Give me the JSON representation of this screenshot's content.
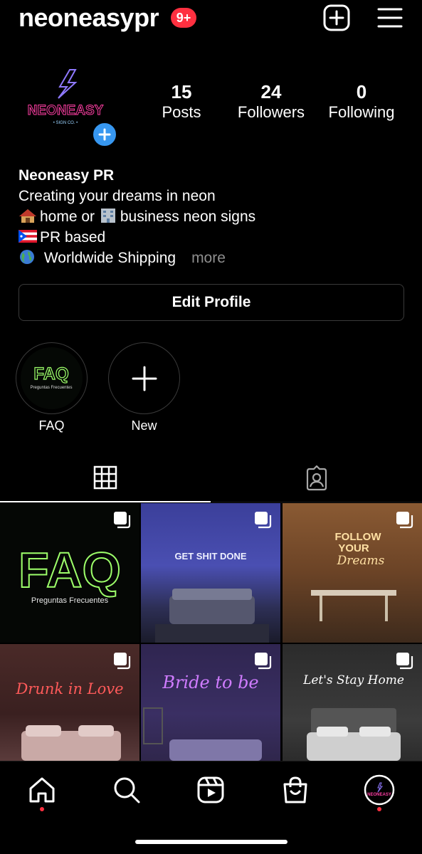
{
  "header": {
    "username": "neoneasypr",
    "notification_badge": "9+",
    "add_icon": "plus-square-icon",
    "menu_icon": "hamburger-menu-icon"
  },
  "profile": {
    "avatar_text": "NEONEASY",
    "avatar_subtext": "• SIGN CO. •",
    "stats": {
      "posts_count": "15",
      "posts_label": "Posts",
      "followers_count": "24",
      "followers_label": "Followers",
      "following_count": "0",
      "following_label": "Following"
    },
    "bio": {
      "name": "Neoneasy PR",
      "line1": "Creating your dreams in neon",
      "line2": "home or ",
      "line2b": "business neon signs",
      "line3": "PR based",
      "line4": " Worldwide Shipping",
      "more": "more"
    },
    "edit_button": "Edit Profile"
  },
  "highlights": [
    {
      "label": "FAQ",
      "cover_title": "FAQ",
      "cover_subtitle": "Preguntas Frecuentes"
    },
    {
      "label": "New"
    }
  ],
  "tabs": [
    {
      "icon": "grid-icon",
      "active": true
    },
    {
      "icon": "tagged-person-icon",
      "active": false
    }
  ],
  "posts": [
    {
      "title": "FAQ",
      "subtitle": "Preguntas Frecuentes",
      "multi": true
    },
    {
      "title": "GET SHIT DONE",
      "multi": true
    },
    {
      "title": "FOLLOW",
      "title2": "YOUR",
      "title3": "Dreams",
      "multi": true
    },
    {
      "title": "Drunk in Love",
      "multi": true
    },
    {
      "title": "Bride to be",
      "multi": true
    },
    {
      "title": "Let's Stay Home",
      "multi": true
    }
  ],
  "bottom_nav": [
    {
      "icon": "home-icon",
      "dot": true
    },
    {
      "icon": "search-icon"
    },
    {
      "icon": "reels-icon"
    },
    {
      "icon": "shop-bag-icon"
    },
    {
      "icon": "profile-avatar-icon",
      "dot": true
    }
  ],
  "colors": {
    "background": "#000000",
    "accent_blue": "#3797f0",
    "badge_red": "#ff3040",
    "muted": "#8e8e8e",
    "neon_green": "#9dff6a",
    "neon_pink": "#ff3fa4"
  }
}
